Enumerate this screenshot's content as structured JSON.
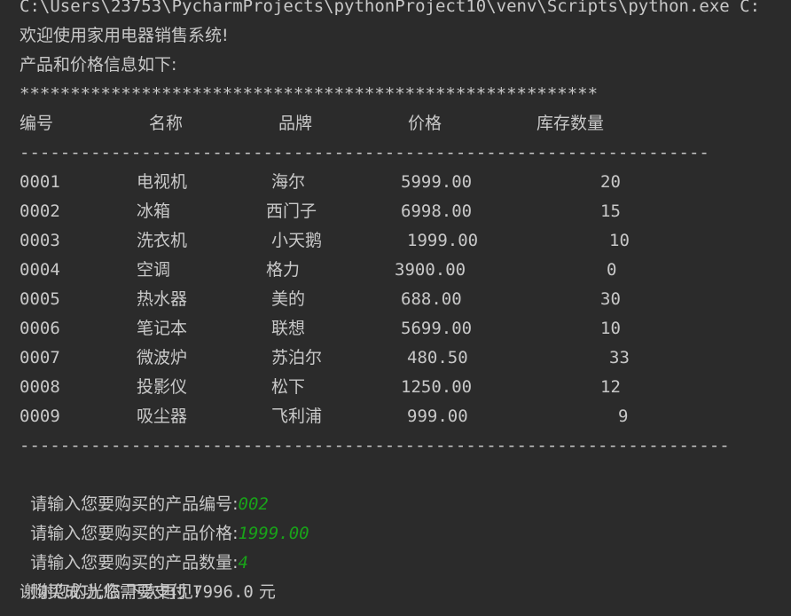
{
  "console": {
    "command_line": "C:\\Users\\23753\\PycharmProjects\\pythonProject10\\venv\\Scripts\\python.exe C:",
    "welcome": "欢迎使用家用电器销售系统!",
    "info_heading": "产品和价格信息如下:",
    "stars": "*********************************************************",
    "divider": "--------------------------------------------------------------------",
    "divider_long": "----------------------------------------------------------------------",
    "table": {
      "headers": [
        "编号",
        "名称",
        "品牌",
        "价格",
        "库存数量"
      ],
      "rows": [
        [
          "0001",
          "电视机",
          "海尔",
          "5999.00",
          "20"
        ],
        [
          "0002",
          "冰箱",
          "西门子",
          "6998.00",
          "15"
        ],
        [
          "0003",
          "洗衣机",
          "小天鹅",
          "1999.00",
          "10"
        ],
        [
          "0004",
          "空调",
          "格力",
          "3900.00",
          "0"
        ],
        [
          "0005",
          "热水器",
          "美的",
          "688.00",
          "30"
        ],
        [
          "0006",
          "笔记本",
          "联想",
          "5699.00",
          "10"
        ],
        [
          "0007",
          "微波炉",
          "苏泊尔",
          "480.50",
          "33"
        ],
        [
          "0008",
          "投影仪",
          "松下",
          "1250.00",
          "12"
        ],
        [
          "0009",
          "吸尘器",
          "飞利浦",
          "999.00",
          "9"
        ]
      ]
    },
    "prompts": [
      {
        "label": "请输入您要购买的产品编号:",
        "value": "002"
      },
      {
        "label": "请输入您要购买的产品价格:",
        "value": "1999.00"
      },
      {
        "label": "请输入您要购买的产品数量:",
        "value": "4"
      }
    ],
    "purchase_prefix": "购买成功,您需要支付 ",
    "purchase_amount": "7996.0",
    "purchase_suffix": " 元",
    "farewell": "谢谢您的光临,下次再见!"
  },
  "colors": {
    "background": "#2b2b2b",
    "text": "#c8c8c8",
    "input": "#19a319"
  }
}
